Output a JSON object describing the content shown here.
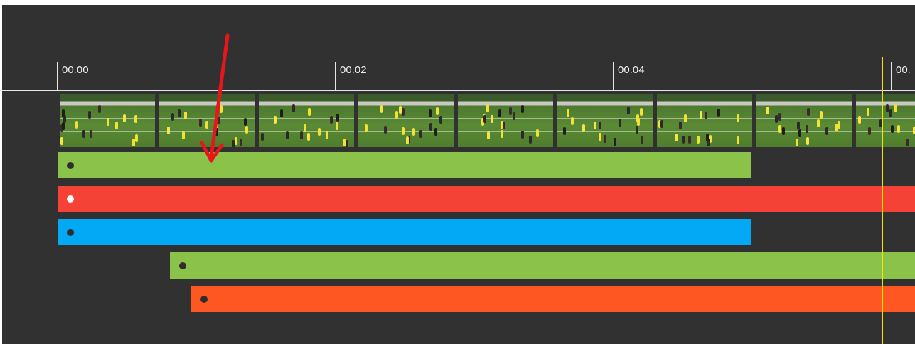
{
  "ruler": {
    "ticks": [
      {
        "label": "00.00"
      },
      {
        "label": "00.02"
      },
      {
        "label": "00.04"
      },
      {
        "label": "00."
      }
    ]
  },
  "filmstrip": {
    "frame_count": 9
  },
  "tracks": [
    {
      "color": "#8bc34a",
      "dot_color": "#2e2e2e"
    },
    {
      "color": "#f44336",
      "dot_color": "#ffffff"
    },
    {
      "color": "#03a9f4",
      "dot_color": "#2e2e2e"
    },
    {
      "color": "#8bc34a",
      "dot_color": "#2e2e2e"
    },
    {
      "color": "#ff5722",
      "dot_color": "#2e2e2e"
    }
  ],
  "colors": {
    "background": "#313131",
    "ruler": "#e6e6e6",
    "playhead": "#f2e600",
    "annotation_arrow": "#e8161b"
  }
}
